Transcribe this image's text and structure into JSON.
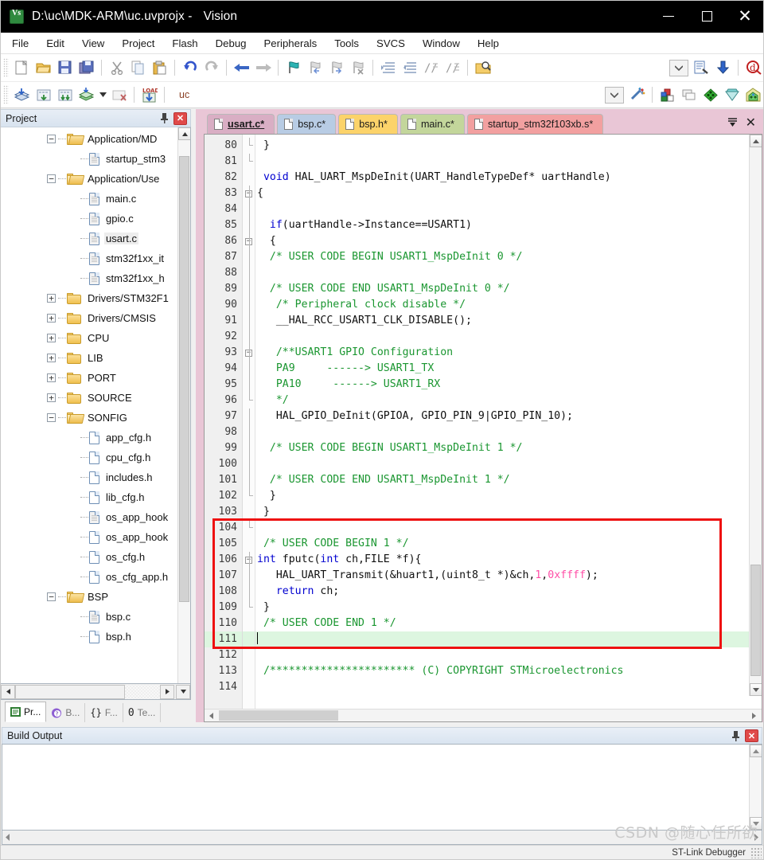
{
  "window": {
    "title_path": "D:\\uc\\MDK-ARM\\uc.uvprojx -",
    "title_app": "Vision",
    "icon": "uvision-logo-icon",
    "controls": {
      "minimize": "minimize-button",
      "maximize": "maximize-button",
      "close": "close-button"
    }
  },
  "menubar": {
    "items": [
      "File",
      "Edit",
      "View",
      "Project",
      "Flash",
      "Debug",
      "Peripherals",
      "Tools",
      "SVCS",
      "Window",
      "Help"
    ]
  },
  "toolbar_main": {
    "buttons": [
      "new-file-icon",
      "open-file-icon",
      "save-icon",
      "save-all-icon",
      "cut-icon",
      "copy-icon",
      "paste-icon",
      "undo-icon",
      "redo-icon",
      "navigate-back-icon",
      "navigate-forward-icon",
      "bookmark-toggle-icon",
      "bookmark-prev-icon",
      "bookmark-next-icon",
      "bookmark-clear-icon",
      "indent-icon",
      "outdent-icon",
      "comment-icon",
      "uncomment-icon",
      "find-in-files-icon"
    ],
    "right_buttons": [
      "dropdown-arrow-icon",
      "configure-icon",
      "download-icon",
      "debug-icon"
    ]
  },
  "toolbar_build": {
    "buttons": [
      "translate-icon",
      "build-icon",
      "rebuild-icon",
      "batch-build-icon",
      "batch-build-dropdown-icon",
      "stop-build-icon",
      "load-icon"
    ],
    "target_combo": {
      "value": "uc",
      "dropdown": "chevron-down-icon"
    },
    "after_combo": [
      "target-options-icon",
      "manage-runtime-icon",
      "multi-project-icon",
      "components-icon",
      "packs-icon",
      "pack-installer-icon"
    ]
  },
  "project_panel": {
    "title": "Project",
    "pin": "pin-icon",
    "close": "close-icon",
    "tree": [
      {
        "depth": 1,
        "toggle": "minus",
        "kind": "folder-open",
        "label": "Application/MD"
      },
      {
        "depth": 2,
        "toggle": "none",
        "kind": "file-gray",
        "label": "startup_stm3"
      },
      {
        "depth": 1,
        "toggle": "minus",
        "kind": "folder-open",
        "label": "Application/Use"
      },
      {
        "depth": 2,
        "toggle": "none",
        "kind": "file-gray",
        "label": "main.c"
      },
      {
        "depth": 2,
        "toggle": "none",
        "kind": "file-gray",
        "label": "gpio.c"
      },
      {
        "depth": 2,
        "toggle": "none",
        "kind": "file-gray",
        "label": "usart.c",
        "selected": true
      },
      {
        "depth": 2,
        "toggle": "none",
        "kind": "file-gray",
        "label": "stm32f1xx_it"
      },
      {
        "depth": 2,
        "toggle": "none",
        "kind": "file-gray",
        "label": "stm32f1xx_h"
      },
      {
        "depth": 1,
        "toggle": "plus",
        "kind": "folder",
        "label": "Drivers/STM32F1"
      },
      {
        "depth": 1,
        "toggle": "plus",
        "kind": "folder",
        "label": "Drivers/CMSIS"
      },
      {
        "depth": 1,
        "toggle": "plus",
        "kind": "folder",
        "label": "CPU"
      },
      {
        "depth": 1,
        "toggle": "plus",
        "kind": "folder",
        "label": "LIB"
      },
      {
        "depth": 1,
        "toggle": "plus",
        "kind": "folder",
        "label": "PORT"
      },
      {
        "depth": 1,
        "toggle": "plus",
        "kind": "folder",
        "label": "SOURCE"
      },
      {
        "depth": 1,
        "toggle": "minus",
        "kind": "folder-open",
        "label": "SONFIG"
      },
      {
        "depth": 2,
        "toggle": "none",
        "kind": "file",
        "label": "app_cfg.h"
      },
      {
        "depth": 2,
        "toggle": "none",
        "kind": "file",
        "label": "cpu_cfg.h"
      },
      {
        "depth": 2,
        "toggle": "none",
        "kind": "file",
        "label": "includes.h"
      },
      {
        "depth": 2,
        "toggle": "none",
        "kind": "file",
        "label": "lib_cfg.h"
      },
      {
        "depth": 2,
        "toggle": "none",
        "kind": "file-gray",
        "label": "os_app_hook"
      },
      {
        "depth": 2,
        "toggle": "none",
        "kind": "file",
        "label": "os_app_hook"
      },
      {
        "depth": 2,
        "toggle": "none",
        "kind": "file",
        "label": "os_cfg.h"
      },
      {
        "depth": 2,
        "toggle": "none",
        "kind": "file",
        "label": "os_cfg_app.h"
      },
      {
        "depth": 1,
        "toggle": "minus",
        "kind": "folder-open",
        "label": "BSP"
      },
      {
        "depth": 2,
        "toggle": "none",
        "kind": "file-gray",
        "label": "bsp.c"
      },
      {
        "depth": 2,
        "toggle": "none",
        "kind": "file",
        "label": "bsp.h"
      }
    ],
    "bottom_tabs": [
      {
        "icon": "project-icon",
        "label": "Pr...",
        "active": true
      },
      {
        "icon": "books-icon",
        "label": "B...",
        "active": false
      },
      {
        "icon": "functions-icon",
        "label": "F...",
        "prefix": "{}",
        "active": false
      },
      {
        "icon": "templates-icon",
        "label": "Te...",
        "prefix": "0",
        "active": false
      }
    ]
  },
  "editor": {
    "tabs": [
      {
        "label": "usart.c*",
        "color": "#d9aec4",
        "active": true
      },
      {
        "label": "bsp.c*",
        "color": "#b8cce4",
        "active": false
      },
      {
        "label": "bsp.h*",
        "color": "#fcd36a",
        "active": false
      },
      {
        "label": "main.c*",
        "color": "#c3d69b",
        "active": false
      },
      {
        "label": "startup_stm32f103xb.s*",
        "color": "#f2a0a0",
        "active": false
      }
    ],
    "tab_menu_icon": "tab-list-icon",
    "tab_close_icon": "close-icon",
    "first_line": 80,
    "lines": [
      {
        "n": 80,
        "fold": "end",
        "tokens": [
          {
            "t": " }",
            "c": "p"
          }
        ]
      },
      {
        "n": 81,
        "fold": "close",
        "tokens": []
      },
      {
        "n": 82,
        "fold": "none",
        "tokens": [
          {
            "t": " ",
            "c": "p"
          },
          {
            "t": "void",
            "c": "kw"
          },
          {
            "t": " HAL_UART_MspDeInit(UART_HandleTypeDef* uartHandle)",
            "c": "p"
          }
        ]
      },
      {
        "n": 83,
        "fold": "box",
        "tokens": [
          {
            "t": "{",
            "c": "p"
          }
        ]
      },
      {
        "n": 84,
        "fold": "bar",
        "tokens": []
      },
      {
        "n": 85,
        "fold": "bar",
        "tokens": [
          {
            "t": "  ",
            "c": "p"
          },
          {
            "t": "if",
            "c": "kw"
          },
          {
            "t": "(uartHandle->Instance==USART1)",
            "c": "p"
          }
        ]
      },
      {
        "n": 86,
        "fold": "box",
        "tokens": [
          {
            "t": "  {",
            "c": "p"
          }
        ]
      },
      {
        "n": 87,
        "fold": "bar",
        "tokens": [
          {
            "t": "  /* USER CODE BEGIN USART1_MspDeInit 0 */",
            "c": "cm"
          }
        ]
      },
      {
        "n": 88,
        "fold": "bar",
        "tokens": []
      },
      {
        "n": 89,
        "fold": "bar",
        "tokens": [
          {
            "t": "  /* USER CODE END USART1_MspDeInit 0 */",
            "c": "cm"
          }
        ]
      },
      {
        "n": 90,
        "fold": "bar",
        "tokens": [
          {
            "t": "   /* Peripheral clock disable */",
            "c": "cm"
          }
        ]
      },
      {
        "n": 91,
        "fold": "bar",
        "tokens": [
          {
            "t": "   __HAL_RCC_USART1_CLK_DISABLE();",
            "c": "p"
          }
        ]
      },
      {
        "n": 92,
        "fold": "bar",
        "tokens": []
      },
      {
        "n": 93,
        "fold": "box",
        "tokens": [
          {
            "t": "   /**USART1 GPIO Configuration",
            "c": "cm"
          }
        ]
      },
      {
        "n": 94,
        "fold": "bar",
        "tokens": [
          {
            "t": "   PA9     ------> USART1_TX",
            "c": "cm"
          }
        ]
      },
      {
        "n": 95,
        "fold": "bar",
        "tokens": [
          {
            "t": "   PA10     ------> USART1_RX",
            "c": "cm"
          }
        ]
      },
      {
        "n": 96,
        "fold": "end",
        "tokens": [
          {
            "t": "   */",
            "c": "cm"
          }
        ]
      },
      {
        "n": 97,
        "fold": "bar",
        "tokens": [
          {
            "t": "   HAL_GPIO_DeInit(GPIOA, GPIO_PIN_9|GPIO_PIN_10);",
            "c": "p"
          }
        ]
      },
      {
        "n": 98,
        "fold": "bar",
        "tokens": []
      },
      {
        "n": 99,
        "fold": "bar",
        "tokens": [
          {
            "t": "  /* USER CODE BEGIN USART1_MspDeInit 1 */",
            "c": "cm"
          }
        ]
      },
      {
        "n": 100,
        "fold": "bar",
        "tokens": []
      },
      {
        "n": 101,
        "fold": "bar",
        "tokens": [
          {
            "t": "  /* USER CODE END USART1_MspDeInit 1 */",
            "c": "cm"
          }
        ]
      },
      {
        "n": 102,
        "fold": "end",
        "tokens": [
          {
            "t": "  }",
            "c": "p"
          }
        ]
      },
      {
        "n": 103,
        "fold": "none",
        "tokens": [
          {
            "t": " }",
            "c": "p"
          }
        ]
      },
      {
        "n": 104,
        "fold": "close",
        "tokens": []
      },
      {
        "n": 105,
        "fold": "none",
        "tokens": [
          {
            "t": " /* USER CODE BEGIN 1 */",
            "c": "cm"
          }
        ]
      },
      {
        "n": 106,
        "fold": "box",
        "tokens": [
          {
            "t": "int",
            "c": "kw"
          },
          {
            "t": " fputc(",
            "c": "p"
          },
          {
            "t": "int",
            "c": "kw"
          },
          {
            "t": " ch,FILE *f){",
            "c": "p"
          }
        ]
      },
      {
        "n": 107,
        "fold": "bar",
        "tokens": [
          {
            "t": "   HAL_UART_Transmit(&huart1,(uint8_t *)&ch,",
            "c": "p"
          },
          {
            "t": "1",
            "c": "num"
          },
          {
            "t": ",",
            "c": "p"
          },
          {
            "t": "0xffff",
            "c": "num"
          },
          {
            "t": ");",
            "c": "p"
          }
        ]
      },
      {
        "n": 108,
        "fold": "bar",
        "tokens": [
          {
            "t": "   ",
            "c": "p"
          },
          {
            "t": "return",
            "c": "kw"
          },
          {
            "t": " ch;",
            "c": "p"
          }
        ]
      },
      {
        "n": 109,
        "fold": "end",
        "tokens": [
          {
            "t": " }",
            "c": "p"
          }
        ]
      },
      {
        "n": 110,
        "fold": "none",
        "tokens": [
          {
            "t": " /* USER CODE END 1 */",
            "c": "cm"
          }
        ]
      },
      {
        "n": 111,
        "fold": "none",
        "tokens": [],
        "current": true,
        "caret": true
      },
      {
        "n": 112,
        "fold": "none",
        "tokens": []
      },
      {
        "n": 113,
        "fold": "none",
        "tokens": [
          {
            "t": " /*********************** (C) COPYRIGHT STMicroelectronics",
            "c": "cm"
          }
        ]
      },
      {
        "n": 114,
        "fold": "none",
        "tokens": []
      }
    ],
    "highlight_box": {
      "color": "#ee1111",
      "from_line": 104,
      "to_line": 111
    }
  },
  "build_output": {
    "title": "Build Output",
    "pin": "pin-icon",
    "close": "close-icon",
    "content": ""
  },
  "statusbar": {
    "text": "ST-Link Debugger"
  },
  "watermark": {
    "text": "CSDN @随心任所欲"
  }
}
